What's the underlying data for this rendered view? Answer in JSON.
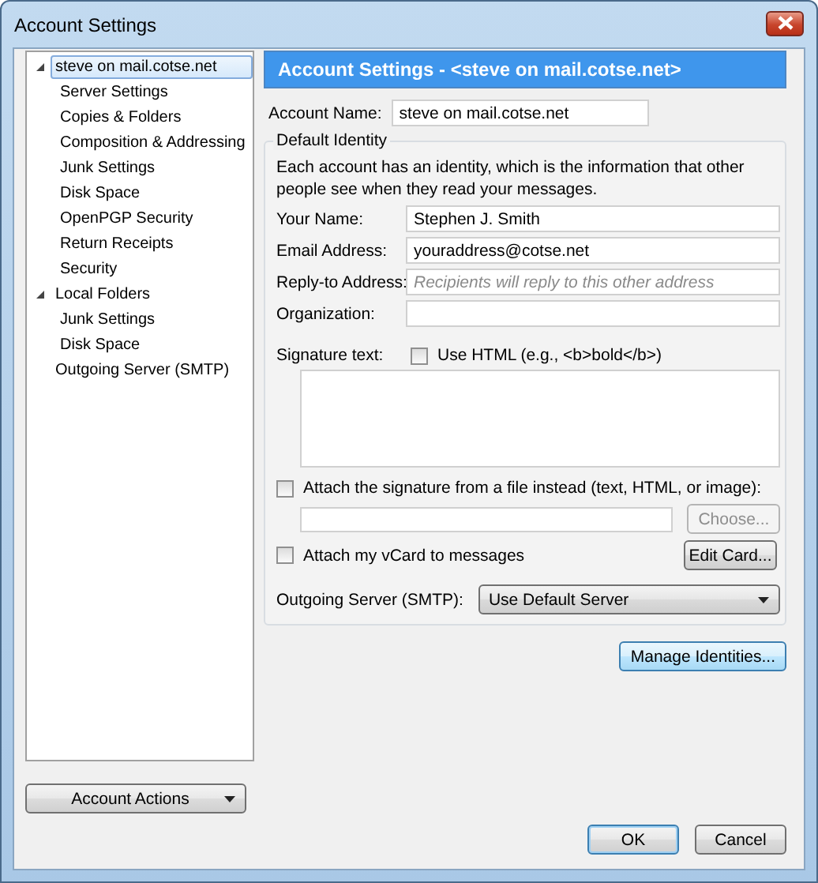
{
  "window": {
    "title": "Account Settings"
  },
  "tree": [
    {
      "label": "steve on mail.cotse.net",
      "selected": true,
      "expanded": true,
      "children": [
        {
          "label": "Server Settings",
          "selected": false
        },
        {
          "label": "Copies & Folders",
          "selected": false
        },
        {
          "label": "Composition & Addressing",
          "selected": false
        },
        {
          "label": "Junk Settings",
          "selected": false
        },
        {
          "label": "Disk Space",
          "selected": false
        },
        {
          "label": "OpenPGP Security",
          "selected": false
        },
        {
          "label": "Return Receipts",
          "selected": false
        },
        {
          "label": "Security",
          "selected": false
        }
      ]
    },
    {
      "label": "Local Folders",
      "selected": false,
      "expanded": true,
      "children": [
        {
          "label": "Junk Settings",
          "selected": false
        },
        {
          "label": "Disk Space",
          "selected": false
        }
      ]
    },
    {
      "label": "Outgoing Server (SMTP)",
      "selected": false
    }
  ],
  "account_actions": {
    "label": "Account Actions"
  },
  "panel": {
    "header": "Account Settings - <steve on mail.cotse.net>",
    "account_name": {
      "label": "Account Name:",
      "value": "steve on mail.cotse.net"
    },
    "identity": {
      "legend": "Default Identity",
      "description": "Each account has an identity, which is the information that other people see when they read your messages.",
      "fields": [
        {
          "label": "Your Name:",
          "value": "Stephen J. Smith"
        },
        {
          "label": "Email Address:",
          "value": "youraddress@cotse.net"
        },
        {
          "label": "Reply-to Address:",
          "placeholder": "Recipients will reply to this other address"
        },
        {
          "label": "Organization:"
        }
      ],
      "signature": {
        "label": "Signature text:",
        "use_html": {
          "label": "Use HTML (e.g., <b>bold</b>)",
          "checked": false
        }
      },
      "attach_file": {
        "label": "Attach the signature from a file instead (text, HTML, or image):",
        "checked": false
      },
      "choose_button": {
        "label": "Choose...",
        "disabled": true
      },
      "vcard": {
        "label": "Attach my vCard to messages",
        "checked": false
      },
      "edit_card_button": {
        "label": "Edit Card...",
        "disabled": false
      },
      "outgoing": {
        "label": "Outgoing Server (SMTP):",
        "value": "Use Default Server"
      }
    },
    "manage_identities_button": {
      "label": "Manage Identities...",
      "focused": true
    }
  },
  "buttons": [
    {
      "label": "OK",
      "default": true
    },
    {
      "label": "Cancel",
      "default": false
    }
  ]
}
